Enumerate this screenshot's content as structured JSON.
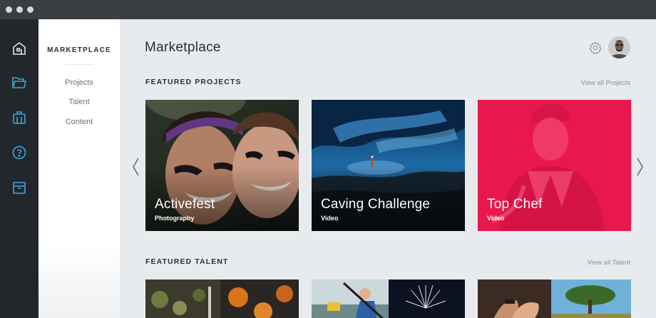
{
  "window": {
    "title": ""
  },
  "rail": {
    "items": [
      {
        "icon": "home-icon"
      },
      {
        "icon": "folder-icon"
      },
      {
        "icon": "briefcase-icon"
      },
      {
        "icon": "help-icon"
      },
      {
        "icon": "store-icon"
      }
    ]
  },
  "subnav": {
    "title": "MARKETPLACE",
    "items": [
      {
        "label": "Projects"
      },
      {
        "label": "Talent"
      },
      {
        "label": "Content"
      }
    ]
  },
  "main": {
    "title": "Marketplace",
    "featured_projects": {
      "heading": "FEATURED PROJECTS",
      "view_all": "View all Projects",
      "cards": [
        {
          "title": "Activefest",
          "category": "Photography"
        },
        {
          "title": "Caving Challenge",
          "category": "Video"
        },
        {
          "title": "Top Chef",
          "category": "Video"
        }
      ]
    },
    "featured_talent": {
      "heading": "FEATURED TALENT",
      "view_all": "View all Talent"
    }
  },
  "colors": {
    "rail_bg": "#22272c",
    "accent": "#3ea8d8",
    "main_bg": "#e8ebee",
    "top_chef_red": "#e8184e"
  }
}
